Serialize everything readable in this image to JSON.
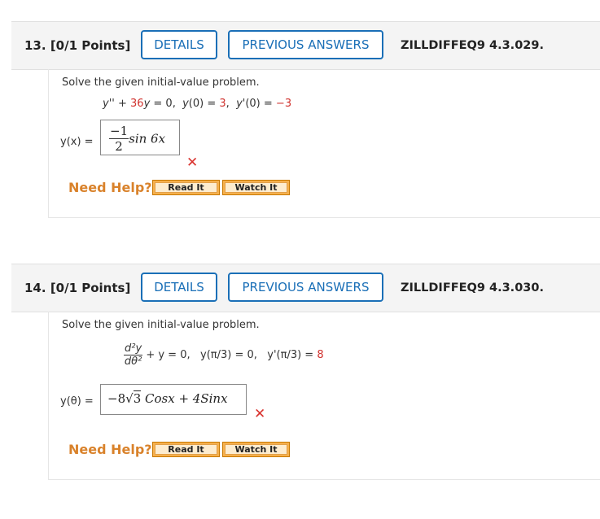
{
  "questions": [
    {
      "number": "13.",
      "points": "[0/1 Points]",
      "details_label": "DETAILS",
      "previous_answers_label": "PREVIOUS ANSWERS",
      "code": "ZILLDIFFEQ9 4.3.029.",
      "prompt": "Solve the given initial-value problem.",
      "equation": "y'' + 36y = 0,",
      "condition1": "y(0) = 3,",
      "condition2": "y'(0) = −3",
      "highlighted_values": [
        "36",
        "3",
        "−3"
      ],
      "answer_label": "y(x) =",
      "answer": {
        "numerator": "−1",
        "denominator": "2",
        "tail": "sin 6x"
      },
      "result": "incorrect",
      "need_help_label": "Need Help?",
      "read_it_label": "Read It",
      "watch_it_label": "Watch It"
    },
    {
      "number": "14.",
      "points": "[0/1 Points]",
      "details_label": "DETAILS",
      "previous_answers_label": "PREVIOUS ANSWERS",
      "code": "ZILLDIFFEQ9 4.3.030.",
      "prompt": "Solve the given initial-value problem.",
      "deriv_num": "d²y",
      "deriv_den": "dθ²",
      "equation_tail": "+ y = 0,",
      "condition1": "y(π/3) = 0,",
      "condition2_prefix": "y'(π/3) =",
      "condition2_value": "8",
      "answer_label": "y(θ) =",
      "answer": {
        "lead": "−8",
        "radicand": "3",
        "tail": "Cosx + 4Sinx"
      },
      "result": "incorrect",
      "need_help_label": "Need Help?",
      "read_it_label": "Read It",
      "watch_it_label": "Watch It"
    }
  ],
  "colors": {
    "link_blue": "#1a6fb7",
    "incorrect_red": "#d9322e",
    "need_help_orange": "#d9822b",
    "highlight_red": "#d0312d"
  },
  "icons": {
    "incorrect": "x-mark-icon"
  }
}
